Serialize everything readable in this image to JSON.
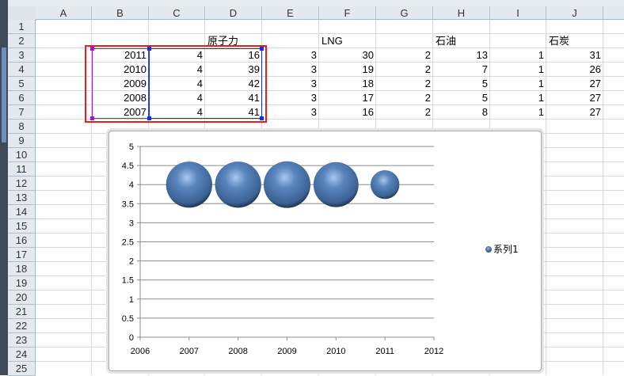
{
  "columns": [
    "A",
    "B",
    "C",
    "D",
    "E",
    "F",
    "G",
    "H",
    "I",
    "J"
  ],
  "rows": [
    "1",
    "2",
    "3",
    "4",
    "5",
    "6",
    "7",
    "8",
    "9",
    "10",
    "11",
    "12",
    "13",
    "14",
    "15",
    "16",
    "17",
    "18",
    "19",
    "20",
    "21",
    "22",
    "23",
    "24",
    "25"
  ],
  "headers": {
    "D": "原子力",
    "F": "LNG",
    "H": "石油",
    "J": "石炭"
  },
  "table": [
    [
      "2011",
      "4",
      "16",
      "3",
      "30",
      "2",
      "13",
      "1",
      "31"
    ],
    [
      "2010",
      "4",
      "39",
      "3",
      "19",
      "2",
      "7",
      "1",
      "26"
    ],
    [
      "2009",
      "4",
      "42",
      "3",
      "18",
      "2",
      "5",
      "1",
      "27"
    ],
    [
      "2008",
      "4",
      "41",
      "3",
      "17",
      "2",
      "5",
      "1",
      "27"
    ],
    [
      "2007",
      "4",
      "41",
      "3",
      "16",
      "2",
      "8",
      "1",
      "27"
    ]
  ],
  "chart_data": {
    "type": "scatter",
    "subtype": "bubble",
    "series": [
      {
        "name": "系列1",
        "x": [
          2011,
          2010,
          2009,
          2008,
          2007
        ],
        "y": [
          4,
          4,
          4,
          4,
          4
        ],
        "size": [
          16,
          39,
          42,
          41,
          41
        ]
      }
    ],
    "xlim": [
      2006,
      2012
    ],
    "ylim": [
      0,
      5
    ],
    "xticks": [
      "2006",
      "2007",
      "2008",
      "2009",
      "2010",
      "2011",
      "2012"
    ],
    "yticks": [
      "0",
      "0.5",
      "1",
      "1.5",
      "2",
      "2.5",
      "3",
      "3.5",
      "4",
      "4.5",
      "5"
    ],
    "grid": true,
    "legend": "right",
    "color": "#4a78b0"
  }
}
